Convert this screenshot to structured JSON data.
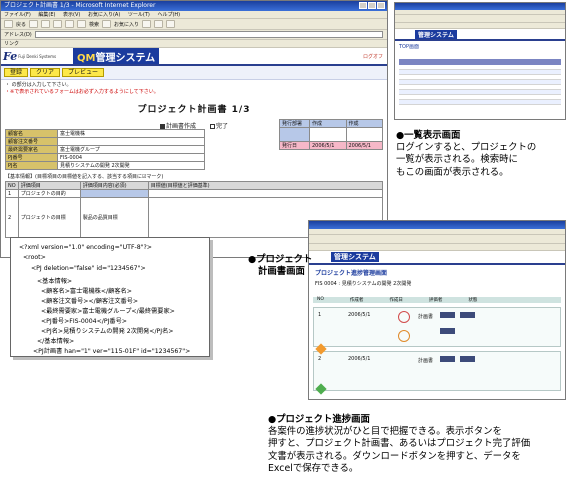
{
  "main_window": {
    "title": "プロジェクト計画書 1/3 - Microsoft Internet Explorer",
    "menu": [
      "ファイル(F)",
      "編集(E)",
      "表示(V)",
      "お気に入り(A)",
      "ツール(T)",
      "ヘルプ(H)"
    ],
    "toolbar": [
      "戻る",
      "検索",
      "お気に入り"
    ],
    "address_label": "アドレス(D)",
    "link_label": "リンク",
    "logo_text": "Fe",
    "logo_sub": "Fuji Denki Systems",
    "system_name_prefix": "QM",
    "system_name": "管理システム",
    "header_right": "ログオフ",
    "buttons": [
      "登録",
      "クリア",
      "プレビュー"
    ],
    "notices": [
      "・ の部分は入力して下さい。",
      "・※で表示されているフォームはお必ず入力するようにして下さい。"
    ],
    "page_title": "プロジェクト計画書 1/3",
    "check_options": [
      {
        "label": "計画書作成",
        "checked": true
      },
      {
        "label": "完了",
        "checked": false
      }
    ],
    "info_table": [
      [
        "顧客名",
        "富士電機株"
      ],
      [
        "顧客注文番号",
        ""
      ],
      [
        "最終需要家名",
        "富士電機グループ"
      ],
      [
        "PJ番号",
        "FIS-0004"
      ],
      [
        "PJ名",
        "見積りシステムの開発 2次開発"
      ]
    ],
    "approval_table": {
      "headers": [
        "発行部署",
        "作成",
        "作成"
      ],
      "dates": [
        "2006/5/1",
        "2006/5/1"
      ],
      "date_label": "発行日"
    },
    "section_label": "【基本情報】(目標項目の目標値を記入する、該当する項目に☑マーク)",
    "table_headers": [
      "NO",
      "評価項目",
      "評価項目内容(必須)",
      "目標値(目標値と評価基準)"
    ],
    "rows": [
      {
        "no": "1",
        "item": "プロジェクトの目的"
      },
      {
        "no": "2",
        "item": "プロジェクトの目標",
        "sub": "製品の品質目標"
      }
    ]
  },
  "xml_snippet": [
    "<?xml version=\"1.0\" encoding=\"UTF-8\"?>",
    "<root>",
    "<PJ deletion=\"false\" id=\"1234567\">",
    "<基本情報>",
    "<顧客名>富士電機株</顧客名>",
    "<顧客注文番号></顧客注文番号>",
    "<最終需要家>富士電機グループ</最終需要家>",
    "<PJ番号>FIS-0004</PJ番号>",
    "<PJ名>見積りシステムの開発 2次開発</PJ名>",
    "</基本情報>",
    "<PJ計画書 han=\"1\" ver=\"115-01F\" id=\"1234567\">"
  ],
  "list_window": {
    "title": "TOP画面",
    "system_name": "管理システム"
  },
  "progress_window": {
    "title": "プロジェクト進捗管理画面",
    "system_name": "管理システム",
    "project_header": "FIS 0004 : 見積りシステムの開発 2次開発",
    "cols": [
      "NO",
      "作成者",
      "作成日",
      "評価者",
      "状態"
    ],
    "rows": [
      {
        "no": "1",
        "date": "2006/5/1",
        "action": "計画書"
      },
      {
        "no": "2",
        "date": "2006/5/1",
        "action": "計画書"
      }
    ]
  },
  "captions": {
    "list": {
      "title": "●一覧表示画面",
      "lines": [
        "ログインすると、プロジェクトの",
        "一覧が表示される。検索時に",
        "もこの画面が表示される。"
      ]
    },
    "plan": {
      "lines": [
        "●プロジェクト",
        "計画書画面"
      ]
    },
    "progress": {
      "title": "●プロジェクト進捗画面",
      "lines": [
        "各案件の進捗状況がひと目で把握できる。表示ボタンを",
        "押すと、プロジェクト計画書、あるいはプロジェクト完了評価",
        "文書が表示される。ダウンロードボタンを押すと、データを",
        "Excelで保存できる。"
      ]
    }
  },
  "colors": {
    "titlebar": "#1a3f9e",
    "header_bar": "#1b3b9e",
    "button_yellow": "#fde84a",
    "label_gold": "#d7c26a",
    "label_pink": "#f6b8c8"
  }
}
